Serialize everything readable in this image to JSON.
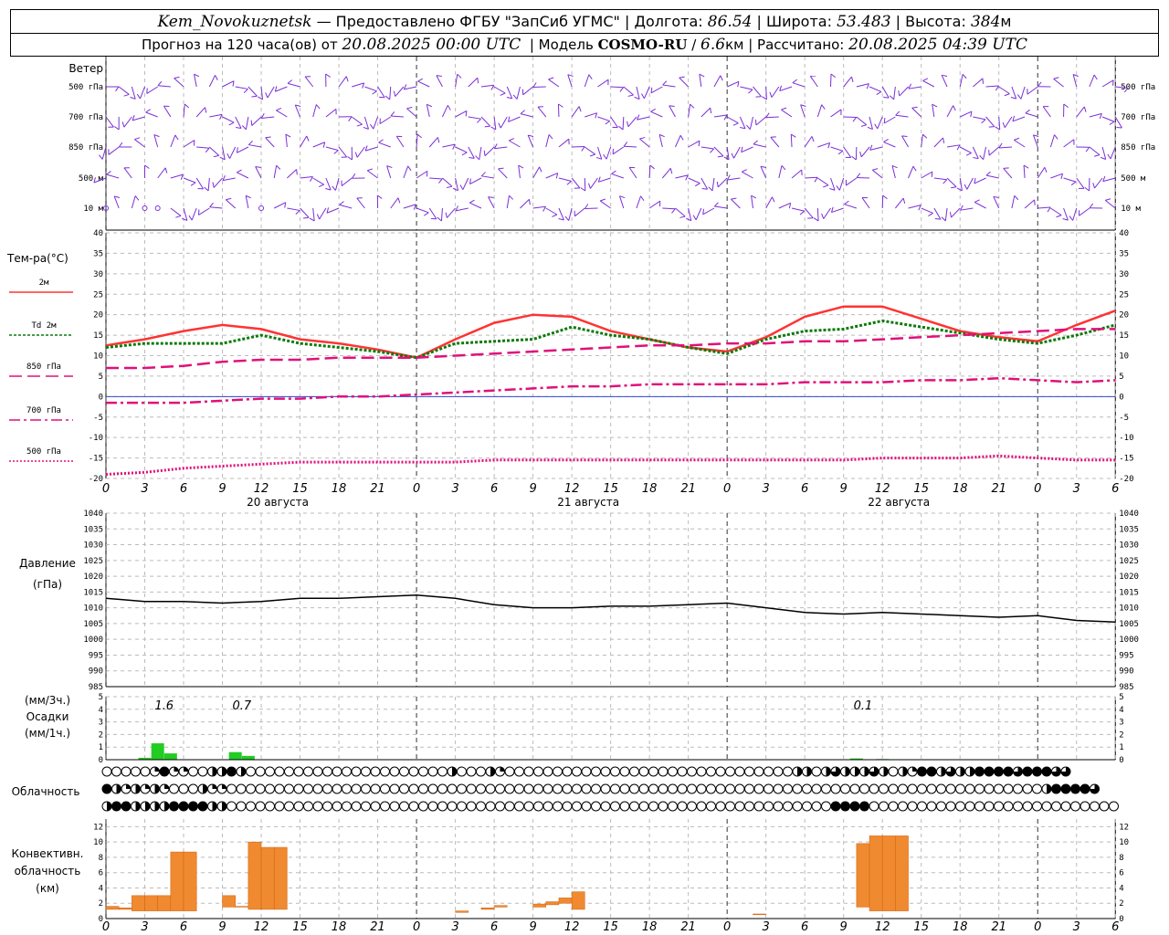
{
  "header": {
    "station": "Kem_Novokuznetsk",
    "provider": "Предоставлено ФГБУ \"ЗапСиб УГМС\"",
    "lon_label": "Долгота:",
    "lon": "86.54",
    "lat_label": "Широта:",
    "lat": "53.483",
    "alt_label": "Высота:",
    "alt": "384",
    "alt_unit": "м",
    "forecast_prefix": "Прогноз на 120 часа(ов) от",
    "forecast_start": "20.08.2025 00:00 UTC",
    "model_label": "Модель",
    "model": "COSMO-RU",
    "resolution": "6.6",
    "resolution_unit": "км",
    "calc_label": "Рассчитано:",
    "calc_time": "20.08.2025 04:39 UTC"
  },
  "hour_ticks": [
    "0",
    "3",
    "6",
    "9",
    "12",
    "15",
    "18",
    "21",
    "0",
    "3",
    "6",
    "9",
    "12",
    "15",
    "18",
    "21",
    "0",
    "3",
    "6",
    "9",
    "12",
    "15",
    "18",
    "21",
    "0",
    "3",
    "6"
  ],
  "day_labels": [
    "20 августа",
    "21 августа",
    "22 августа"
  ],
  "panels": {
    "wind": {
      "title": "Ветер",
      "levels": [
        "500 гПа",
        "700 гПа",
        "850 гПа",
        "500 м",
        "10  м"
      ]
    },
    "temp": {
      "title": "Тем-ра(°C)",
      "ticks": [
        "40",
        "35",
        "30",
        "25",
        "20",
        "15",
        "10",
        "5",
        "0",
        "-5",
        "-10",
        "-15",
        "-20"
      ],
      "legend": [
        {
          "label": "2м",
          "style": "solid",
          "color": "#ff3333"
        },
        {
          "label": "Td 2м",
          "style": "dotted",
          "color": "#0a7a0a"
        },
        {
          "label": "850 гПа",
          "style": "dash",
          "color": "#e0107a"
        },
        {
          "label": "700 гПа",
          "style": "dashdot",
          "color": "#e0107a"
        },
        {
          "label": "500 гПа",
          "style": "dot",
          "color": "#e0107a"
        }
      ]
    },
    "pressure": {
      "title": "Давление",
      "unit": "(гПа)",
      "ticks": [
        "1040",
        "1035",
        "1030",
        "1025",
        "1020",
        "1015",
        "1010",
        "1005",
        "1000",
        "995",
        "990",
        "985"
      ]
    },
    "precip": {
      "unit3": "(мм/3ч.)",
      "title": "Осадки",
      "unit1": "(мм/1ч.)",
      "ticks": [
        "5",
        "4",
        "3",
        "2",
        "1",
        "0"
      ],
      "totals": [
        {
          "hour": 4.5,
          "text": "1.6"
        },
        {
          "hour": 10.5,
          "text": "0.7"
        },
        {
          "hour": 58.5,
          "text": "0.1"
        }
      ]
    },
    "clouds": {
      "title": "Облачность"
    },
    "conv": {
      "title": "Конвективн.",
      "title2": "облачность",
      "unit": "(км)",
      "ticks": [
        "12",
        "10",
        "8",
        "6",
        "4",
        "2",
        "0"
      ]
    }
  },
  "colors": {
    "t2m": "#ff3333",
    "td": "#0a7a0a",
    "upper": "#e0107a",
    "wind": "#7a2fd6",
    "precip": "#22cc22",
    "conv": "#f08a30",
    "pressure": "#000000"
  },
  "chart_data": [
    {
      "type": "line",
      "title": "Тем-ра(°C)",
      "x_unit": "hours since 20.08.2025 00:00 UTC",
      "ylim": [
        -20,
        40
      ],
      "series": [
        {
          "name": "2м",
          "x": [
            0,
            3,
            6,
            9,
            12,
            15,
            18,
            21,
            24,
            27,
            30,
            33,
            36,
            39,
            42,
            45,
            48,
            51,
            54,
            57,
            60,
            63,
            66,
            69,
            72,
            75,
            78
          ],
          "values": [
            12.5,
            14,
            16,
            17.5,
            16.5,
            14,
            13,
            11.5,
            9.5,
            14,
            18,
            20,
            19.5,
            16,
            14,
            12,
            11,
            14.5,
            19.5,
            22,
            22,
            19,
            16,
            14.5,
            13.5,
            17.5,
            21
          ]
        },
        {
          "name": "Td 2м",
          "x": [
            0,
            3,
            6,
            9,
            12,
            15,
            18,
            21,
            24,
            27,
            30,
            33,
            36,
            39,
            42,
            45,
            48,
            51,
            54,
            57,
            60,
            63,
            66,
            69,
            72,
            75,
            78
          ],
          "values": [
            12,
            13,
            13,
            13,
            15,
            13,
            12,
            11,
            9.5,
            13,
            13.5,
            14,
            17,
            15,
            14,
            12,
            10.5,
            14,
            16,
            16.5,
            18.5,
            17,
            15.5,
            14,
            13,
            15,
            17.5
          ]
        },
        {
          "name": "850 гПа",
          "x": [
            0,
            3,
            6,
            9,
            12,
            15,
            18,
            21,
            24,
            27,
            30,
            33,
            36,
            39,
            42,
            45,
            48,
            51,
            54,
            57,
            60,
            63,
            66,
            69,
            72,
            75,
            78
          ],
          "values": [
            7,
            7,
            7.5,
            8.5,
            9,
            9,
            9.5,
            9.5,
            9.5,
            10,
            10.5,
            11,
            11.5,
            12,
            12.5,
            12.5,
            13,
            13,
            13.5,
            13.5,
            14,
            14.5,
            15,
            15.5,
            16,
            16.5,
            16.5
          ]
        },
        {
          "name": "700 гПа",
          "x": [
            0,
            3,
            6,
            9,
            12,
            15,
            18,
            21,
            24,
            27,
            30,
            33,
            36,
            39,
            42,
            45,
            48,
            51,
            54,
            57,
            60,
            63,
            66,
            69,
            72,
            75,
            78
          ],
          "values": [
            -1.5,
            -1.5,
            -1.5,
            -1,
            -0.5,
            -0.5,
            0,
            0,
            0.5,
            1,
            1.5,
            2,
            2.5,
            2.5,
            3,
            3,
            3,
            3,
            3.5,
            3.5,
            3.5,
            4,
            4,
            4.5,
            4,
            3.5,
            4
          ]
        },
        {
          "name": "500 гПа",
          "x": [
            0,
            3,
            6,
            9,
            12,
            15,
            18,
            21,
            24,
            27,
            30,
            33,
            36,
            39,
            42,
            45,
            48,
            51,
            54,
            57,
            60,
            63,
            66,
            69,
            72,
            75,
            78
          ],
          "values": [
            -19,
            -18.5,
            -17.5,
            -17,
            -16.5,
            -16,
            -16,
            -16,
            -16,
            -16,
            -15.5,
            -15.5,
            -15.5,
            -15.5,
            -15.5,
            -15.5,
            -15.5,
            -15.5,
            -15.5,
            -15.5,
            -15,
            -15,
            -15,
            -14.5,
            -15,
            -15.5,
            -15.5
          ]
        }
      ]
    },
    {
      "type": "line",
      "title": "Давление",
      "ylim": [
        985,
        1040
      ],
      "series": [
        {
          "name": "Давление",
          "x": [
            0,
            3,
            6,
            9,
            12,
            15,
            18,
            21,
            24,
            27,
            30,
            33,
            36,
            39,
            42,
            45,
            48,
            51,
            54,
            57,
            60,
            63,
            66,
            69,
            72,
            75,
            78
          ],
          "values": [
            1013,
            1012,
            1012,
            1011.5,
            1012,
            1013,
            1013,
            1013.5,
            1014,
            1013,
            1011,
            1010,
            1010,
            1010.5,
            1010.5,
            1011,
            1011.5,
            1010,
            1008.5,
            1008,
            1008.5,
            1008,
            1007.5,
            1007,
            1007.5,
            1006,
            1005.5
          ]
        }
      ]
    },
    {
      "type": "bar",
      "title": "Осадки",
      "series": [
        {
          "name": "мм/1ч",
          "x": [
            3,
            4,
            5,
            10,
            11,
            58,
            60
          ],
          "values": [
            0.15,
            1.3,
            0.5,
            0.6,
            0.3,
            0.1,
            0.05
          ]
        }
      ]
    },
    {
      "type": "bar",
      "title": "Конвективн. облачность",
      "ylim": [
        0,
        13
      ],
      "series": [
        {
          "name": "base_top_km",
          "bars": [
            [
              0,
              1.2,
              1.6
            ],
            [
              1,
              1.2,
              1.4
            ],
            [
              2,
              1,
              3
            ],
            [
              3,
              1,
              3
            ],
            [
              4,
              1,
              3
            ],
            [
              5,
              1,
              8.7
            ],
            [
              6,
              1,
              8.7
            ],
            [
              9,
              1.5,
              3
            ],
            [
              10,
              1.5,
              1.6
            ],
            [
              11,
              1.2,
              10
            ],
            [
              12,
              1.2,
              9.3
            ],
            [
              13,
              1.2,
              9.3
            ],
            [
              27,
              0.8,
              1
            ],
            [
              29,
              1.2,
              1.4
            ],
            [
              30,
              1.5,
              1.7
            ],
            [
              33,
              1.5,
              1.9
            ],
            [
              34,
              1.8,
              2.2
            ],
            [
              35,
              2,
              2.7
            ],
            [
              36,
              1.2,
              3.5
            ],
            [
              50,
              0.5,
              0.6
            ],
            [
              58,
              1.5,
              9.8
            ],
            [
              59,
              1,
              10.8
            ],
            [
              60,
              1,
              10.8
            ],
            [
              61,
              1,
              10.8
            ]
          ]
        }
      ]
    },
    {
      "type": "table",
      "title": "Облачность",
      "rows": 3,
      "cover_eighths": [
        [
          0,
          0,
          0,
          0,
          0,
          2,
          8,
          2,
          2,
          0,
          0,
          4,
          4,
          8,
          4,
          0,
          0,
          0,
          0,
          0,
          0,
          0,
          0,
          0,
          0,
          0,
          0,
          0,
          0,
          0,
          0,
          0,
          0,
          0,
          0,
          0,
          4,
          0,
          0,
          0,
          4,
          2,
          0,
          0,
          0,
          0,
          0,
          0,
          0,
          0,
          0,
          0,
          0,
          0,
          0,
          0,
          0,
          0,
          0,
          0,
          0,
          0,
          0,
          0,
          0,
          0,
          0,
          0,
          0,
          0,
          0,
          0,
          4,
          4,
          0,
          4,
          6,
          4,
          4,
          4,
          6,
          4,
          0,
          4,
          2,
          8,
          8,
          4,
          6,
          4,
          4,
          8,
          8,
          8,
          8,
          6,
          8,
          8,
          8,
          6,
          6
        ],
        [
          8,
          4,
          2,
          4,
          2,
          4,
          2,
          0,
          0,
          0,
          4,
          2,
          2,
          0,
          0,
          0,
          0,
          0,
          0,
          0,
          0,
          0,
          0,
          0,
          0,
          0,
          0,
          0,
          0,
          0,
          0,
          0,
          0,
          0,
          0,
          0,
          0,
          0,
          0,
          0,
          0,
          0,
          0,
          0,
          0,
          0,
          0,
          0,
          0,
          0,
          0,
          0,
          0,
          0,
          0,
          0,
          0,
          0,
          0,
          0,
          0,
          0,
          0,
          0,
          0,
          0,
          0,
          0,
          0,
          0,
          0,
          0,
          0,
          0,
          0,
          0,
          0,
          0,
          0,
          0,
          0,
          0,
          0,
          0,
          0,
          0,
          0,
          0,
          0,
          0,
          0,
          0,
          0,
          0,
          0,
          0,
          0,
          0,
          4,
          8,
          8,
          8,
          8,
          6
        ],
        [
          4,
          8,
          8,
          4,
          4,
          4,
          4,
          8,
          8,
          8,
          8,
          4,
          4,
          0,
          0,
          0,
          0,
          0,
          0,
          0,
          0,
          0,
          0,
          0,
          0,
          0,
          0,
          0,
          0,
          0,
          0,
          0,
          0,
          0,
          0,
          0,
          0,
          0,
          0,
          0,
          0,
          0,
          0,
          0,
          0,
          0,
          0,
          0,
          0,
          0,
          0,
          0,
          0,
          0,
          0,
          0,
          0,
          0,
          0,
          0,
          0,
          0,
          0,
          0,
          0,
          0,
          0,
          0,
          0,
          0,
          0,
          0,
          0,
          0,
          0,
          0,
          8,
          8,
          8,
          8,
          0,
          0,
          0,
          0,
          0,
          0,
          0,
          0,
          0,
          0,
          0,
          0,
          0,
          0,
          0,
          0,
          0,
          0,
          0,
          0,
          0,
          0,
          0,
          0,
          0,
          0
        ]
      ]
    }
  ]
}
